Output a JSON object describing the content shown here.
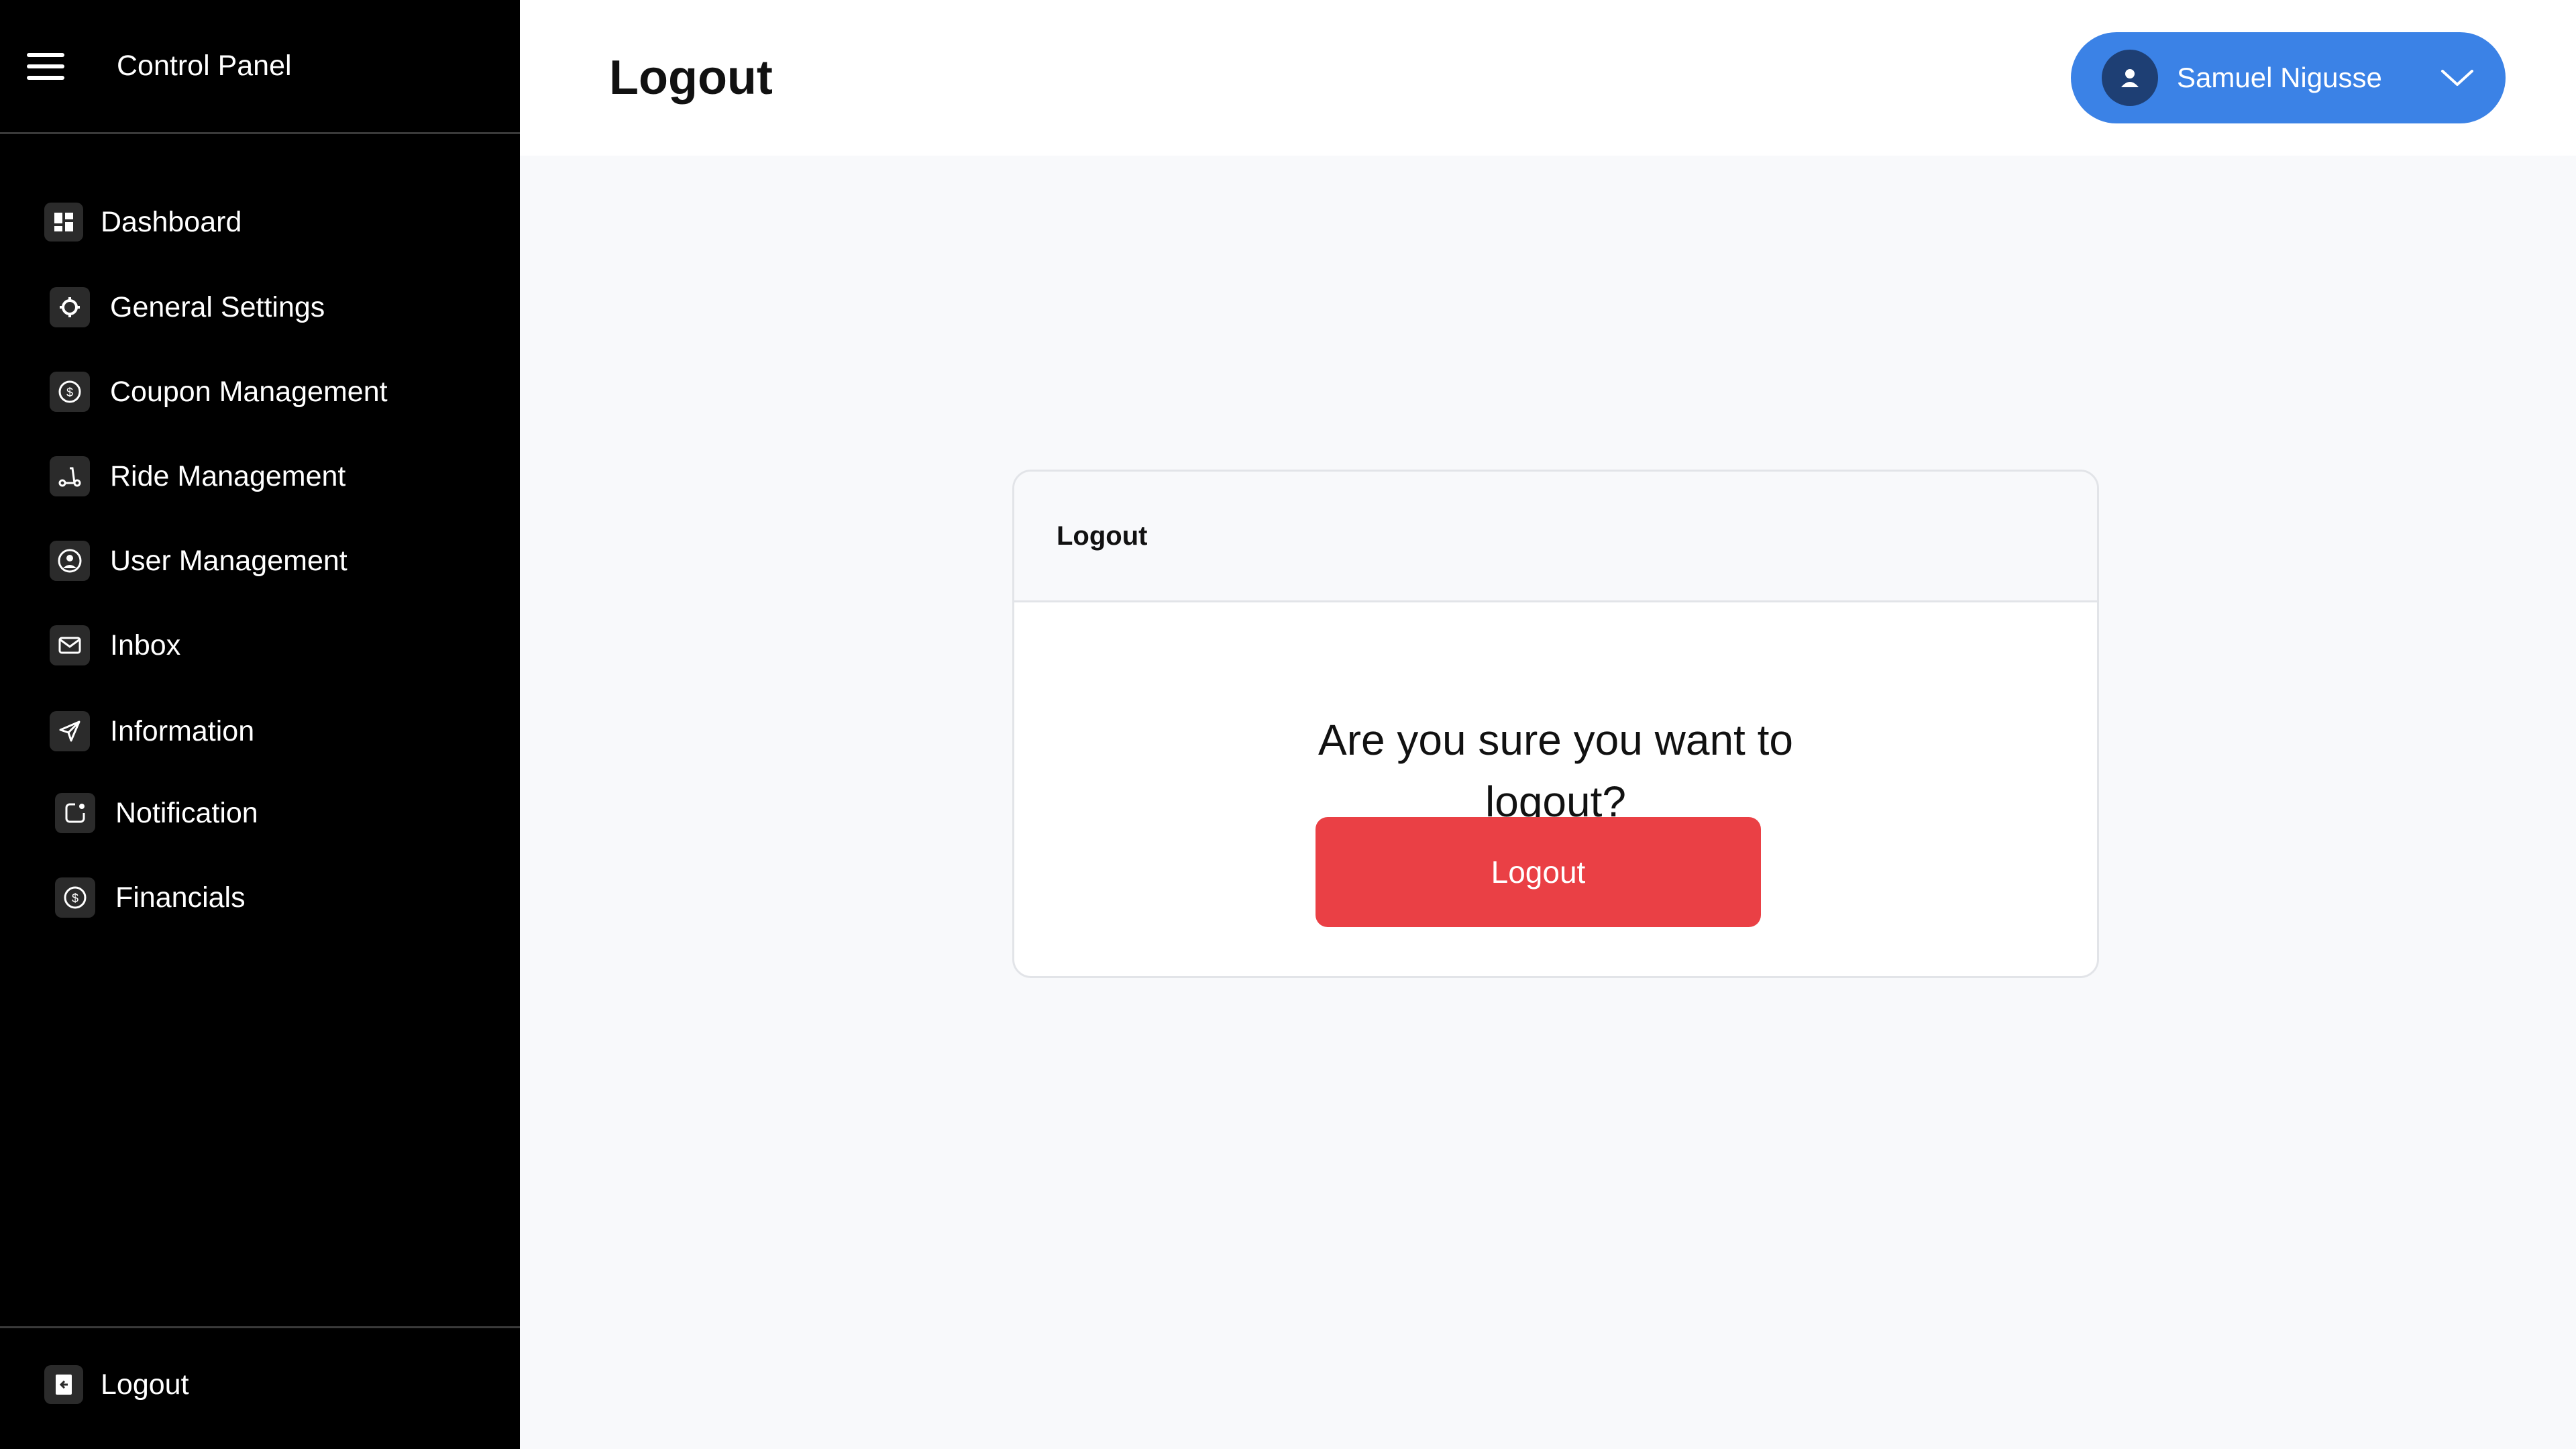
{
  "sidebar": {
    "title": "Control Panel",
    "items": [
      {
        "label": "Dashboard",
        "icon": "dashboard-icon"
      },
      {
        "label": "General Settings",
        "icon": "gear-icon"
      },
      {
        "label": "Coupon Management",
        "icon": "coin-icon"
      },
      {
        "label": "Ride Management",
        "icon": "scooter-icon"
      },
      {
        "label": "User Management",
        "icon": "user-circle-icon"
      },
      {
        "label": "Inbox",
        "icon": "mail-icon"
      },
      {
        "label": "Information",
        "icon": "send-icon"
      },
      {
        "label": "Notification",
        "icon": "notification-icon"
      },
      {
        "label": "Financials",
        "icon": "coin-icon"
      }
    ],
    "footer": {
      "label": "Logout",
      "icon": "logout-icon"
    }
  },
  "header": {
    "title": "Logout",
    "user": {
      "name": "Samuel Nigusse"
    }
  },
  "card": {
    "title": "Logout",
    "message_line1": "Are you sure you want to",
    "message_line2": "logout?",
    "button_label": "Logout"
  },
  "colors": {
    "sidebar_bg": "#000000",
    "accent": "#3b82e6",
    "danger": "#ea4045",
    "content_bg": "#f8f9fb"
  }
}
